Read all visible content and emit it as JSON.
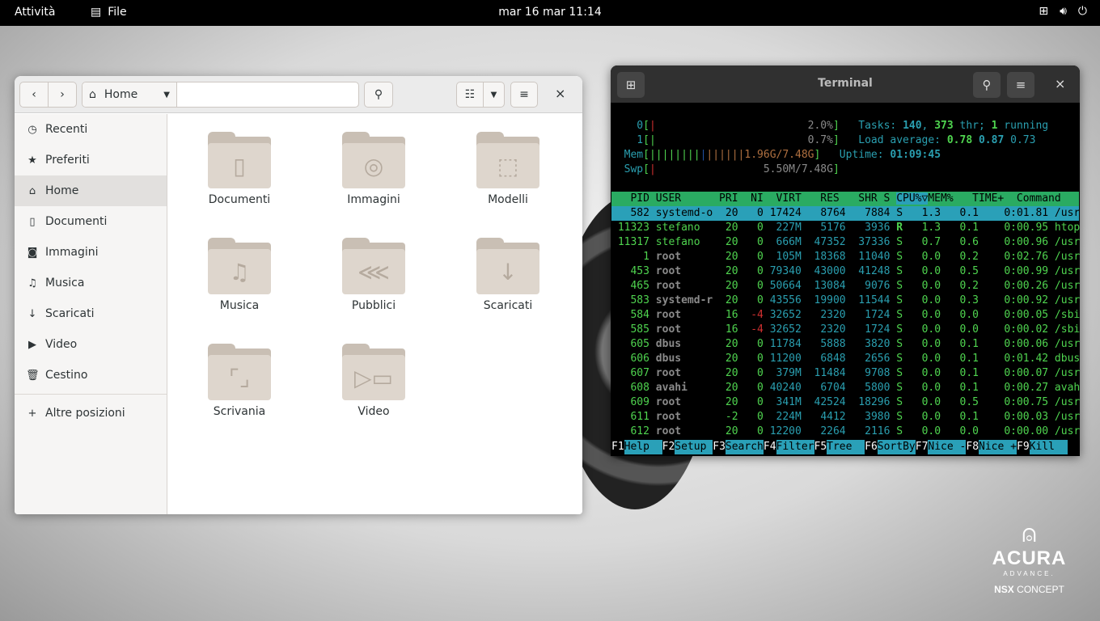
{
  "topbar": {
    "activities": "Attività",
    "app": "File",
    "clock": "mar 16 mar  11:14",
    "tray": [
      "network-icon",
      "volume-icon",
      "power-icon"
    ]
  },
  "wallpaper": {
    "brand": "ACURA",
    "sub": "ADVANCE.",
    "model_bold": "NSX",
    "model": "CONCEPT"
  },
  "files": {
    "path": "Home",
    "search_value": "",
    "sidebar": [
      {
        "label": "Recenti",
        "icon": "clock-icon",
        "glyph": "◷"
      },
      {
        "label": "Preferiti",
        "icon": "star-icon",
        "glyph": "★"
      },
      {
        "label": "Home",
        "icon": "home-icon",
        "glyph": "⌂",
        "selected": true
      },
      {
        "label": "Documenti",
        "icon": "document-icon",
        "glyph": "▯"
      },
      {
        "label": "Immagini",
        "icon": "camera-icon",
        "glyph": "◙"
      },
      {
        "label": "Musica",
        "icon": "music-icon",
        "glyph": "♫"
      },
      {
        "label": "Scaricati",
        "icon": "download-icon",
        "glyph": "↓"
      },
      {
        "label": "Video",
        "icon": "video-icon",
        "glyph": "▶"
      },
      {
        "label": "Cestino",
        "icon": "trash-icon",
        "glyph": "🗑"
      }
    ],
    "other_locations": "Altre posizioni",
    "folders": [
      {
        "label": "Documenti",
        "glyph": "▯"
      },
      {
        "label": "Immagini",
        "glyph": "◎"
      },
      {
        "label": "Modelli",
        "glyph": "⬚"
      },
      {
        "label": "Musica",
        "glyph": "♫"
      },
      {
        "label": "Pubblici",
        "glyph": "⋘"
      },
      {
        "label": "Scaricati",
        "glyph": "↓"
      },
      {
        "label": "Scrivania",
        "glyph": "⌜⌟"
      },
      {
        "label": "Video",
        "glyph": "▷▭"
      }
    ]
  },
  "terminal": {
    "title": "Terminal",
    "meters": {
      "cpu0": "2.0%",
      "cpu1": "0.7%",
      "mem": "1.96G/7.48G",
      "swp": "5.50M/7.48G"
    },
    "tasks": {
      "count": "140",
      "threads": "373",
      "running": "1"
    },
    "load": [
      "0.78",
      "0.87",
      "0.73"
    ],
    "uptime": "01:09:45",
    "columns": [
      "PID",
      "USER",
      "PRI",
      "NI",
      "VIRT",
      "RES",
      "SHR",
      "S",
      "CPU%▽",
      "MEM%",
      "TIME+",
      "Command"
    ],
    "processes": [
      [
        "582",
        "systemd-o",
        "20",
        "0",
        "17424",
        "8764",
        "7884",
        "S",
        "1.3",
        "0.1",
        "0:01.81",
        "/usr/li"
      ],
      [
        "11323",
        "stefano",
        "20",
        "0",
        "227M",
        "5176",
        "3936",
        "R",
        "1.3",
        "0.1",
        "0:00.95",
        "htop"
      ],
      [
        "11317",
        "stefano",
        "20",
        "0",
        "666M",
        "47352",
        "37336",
        "S",
        "0.7",
        "0.6",
        "0:00.96",
        "/usr/li"
      ],
      [
        "1",
        "root",
        "20",
        "0",
        "105M",
        "18368",
        "11040",
        "S",
        "0.0",
        "0.2",
        "0:02.76",
        "/usr/li"
      ],
      [
        "453",
        "root",
        "20",
        "0",
        "79340",
        "43000",
        "41248",
        "S",
        "0.0",
        "0.5",
        "0:00.99",
        "/usr/li"
      ],
      [
        "465",
        "root",
        "20",
        "0",
        "50664",
        "13084",
        "9076",
        "S",
        "0.0",
        "0.2",
        "0:00.26",
        "/usr/li"
      ],
      [
        "583",
        "systemd-r",
        "20",
        "0",
        "43556",
        "19900",
        "11544",
        "S",
        "0.0",
        "0.3",
        "0:00.92",
        "/usr/li"
      ],
      [
        "584",
        "root",
        "16",
        "-4",
        "32652",
        "2320",
        "1724",
        "S",
        "0.0",
        "0.0",
        "0:00.05",
        "/sbin/a"
      ],
      [
        "585",
        "root",
        "16",
        "-4",
        "32652",
        "2320",
        "1724",
        "S",
        "0.0",
        "0.0",
        "0:00.02",
        "/sbin/a"
      ],
      [
        "605",
        "dbus",
        "20",
        "0",
        "11784",
        "5888",
        "3820",
        "S",
        "0.0",
        "0.1",
        "0:00.06",
        "/usr/bi"
      ],
      [
        "606",
        "dbus",
        "20",
        "0",
        "11200",
        "6848",
        "2656",
        "S",
        "0.0",
        "0.1",
        "0:01.42",
        "dbus-br"
      ],
      [
        "607",
        "root",
        "20",
        "0",
        "379M",
        "11484",
        "9708",
        "S",
        "0.0",
        "0.1",
        "0:00.07",
        "/usr/sb"
      ],
      [
        "608",
        "avahi",
        "20",
        "0",
        "40240",
        "6704",
        "5800",
        "S",
        "0.0",
        "0.1",
        "0:00.27",
        "avahi-d"
      ],
      [
        "609",
        "root",
        "20",
        "0",
        "341M",
        "42524",
        "18296",
        "S",
        "0.0",
        "0.5",
        "0:00.75",
        "/usr/bi"
      ],
      [
        "611",
        "root",
        "-2",
        "0",
        "224M",
        "4412",
        "3980",
        "S",
        "0.0",
        "0.1",
        "0:00.03",
        "/usr/li"
      ],
      [
        "612",
        "root",
        "20",
        "0",
        "12200",
        "2264",
        "2116",
        "S",
        "0.0",
        "0.0",
        "0:00.00",
        "/usr/sb"
      ]
    ],
    "fkeys": [
      [
        "F1",
        "Help  "
      ],
      [
        "F2",
        "Setup "
      ],
      [
        "F3",
        "Search"
      ],
      [
        "F4",
        "Filter"
      ],
      [
        "F5",
        "Tree  "
      ],
      [
        "F6",
        "SortBy"
      ],
      [
        "F7",
        "Nice -"
      ],
      [
        "F8",
        "Nice +"
      ],
      [
        "F9",
        "Kill  "
      ]
    ]
  }
}
